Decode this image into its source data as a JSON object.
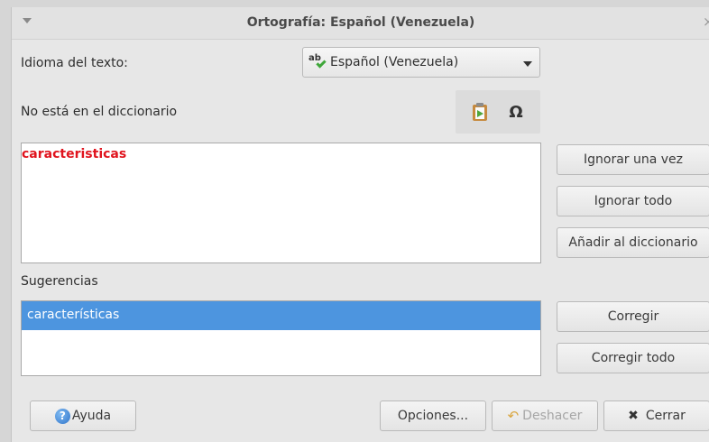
{
  "window": {
    "title": "Ortografía: Español (Venezuela)",
    "close_glyph": "×",
    "menu_icon": "chevron-down-icon"
  },
  "language": {
    "label": "Idioma del texto:",
    "selected": "Español (Venezuela)",
    "icon_text": "ab",
    "icon": "spellcheck-icon"
  },
  "not_in_dictionary": {
    "label": "No está en el diccionario",
    "word": "caracteristicas",
    "word_color": "#e0141e"
  },
  "toolbar": {
    "paste_icon": "paste-icon",
    "special_char_icon": "omega-icon",
    "special_char_glyph": "Ω"
  },
  "suggestions": {
    "label": "Sugerencias",
    "items": [
      "características"
    ],
    "selected_color": "#4d95df"
  },
  "side_buttons": {
    "ignore_once": "Ignorar una vez",
    "ignore_all": "Ignorar todo",
    "add_to_dictionary": "Añadir al diccionario",
    "correct": "Corregir",
    "correct_all": "Corregir todo"
  },
  "footer": {
    "help": "Ayuda",
    "help_glyph": "?",
    "options": "Opciones...",
    "undo": "Deshacer",
    "undo_enabled": false,
    "close": "Cerrar",
    "close_glyph": "✖",
    "undo_glyph": "↶"
  }
}
